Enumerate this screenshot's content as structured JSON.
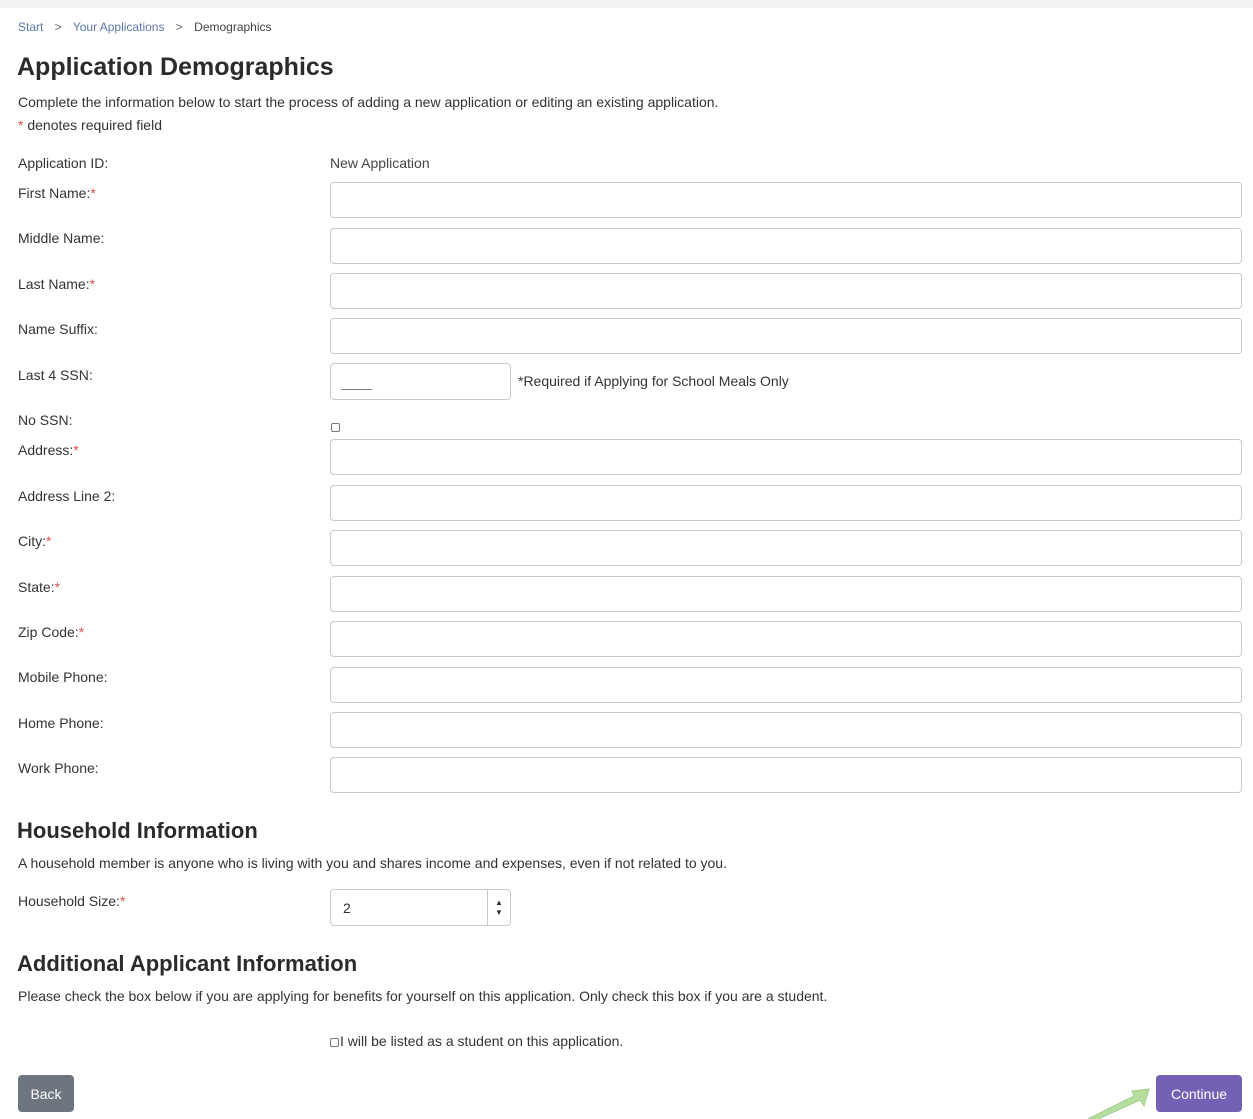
{
  "breadcrumb": {
    "items": [
      "Start",
      "Your Applications",
      "Demographics"
    ],
    "separator": ">"
  },
  "title": "Application Demographics",
  "intro": "Complete the information below to start the process of adding a new application or editing an existing application.",
  "required_note": {
    "asterisk": "*",
    "text": " denotes required field"
  },
  "fields": {
    "application_id": {
      "label": "Application ID:",
      "value": "New Application"
    },
    "first_name": {
      "label": "First Name:",
      "required": "*",
      "value": ""
    },
    "middle_name": {
      "label": "Middle Name:",
      "value": ""
    },
    "last_name": {
      "label": "Last Name:",
      "required": "*",
      "value": ""
    },
    "name_suffix": {
      "label": "Name Suffix:",
      "value": ""
    },
    "last4_ssn": {
      "label": "Last 4 SSN:",
      "placeholder": "____",
      "note": "*Required if Applying for School Meals Only"
    },
    "no_ssn": {
      "label": "No SSN:",
      "checked": false
    },
    "address": {
      "label": "Address:",
      "required": "*",
      "value": ""
    },
    "address2": {
      "label": "Address Line 2:",
      "value": ""
    },
    "city": {
      "label": "City:",
      "required": "*",
      "value": ""
    },
    "state": {
      "label": "State:",
      "required": "*",
      "value": ""
    },
    "zip": {
      "label": "Zip Code:",
      "required": "*",
      "value": ""
    },
    "mobile_phone": {
      "label": "Mobile Phone:",
      "value": ""
    },
    "home_phone": {
      "label": "Home Phone:",
      "value": ""
    },
    "work_phone": {
      "label": "Work Phone:",
      "value": ""
    }
  },
  "household": {
    "heading": "Household Information",
    "description": "A household member is anyone who is living with you and shares income and expenses, even if not related to you.",
    "size_label": "Household Size:",
    "size_required": "*",
    "size_value": "2"
  },
  "additional": {
    "heading": "Additional Applicant Information",
    "description": "Please check the box below if you are applying for benefits for yourself on this application. Only check this box if you are a student.",
    "student_label": "I will be listed as a student on this application.",
    "student_checked": false
  },
  "buttons": {
    "back": "Back",
    "continue": "Continue"
  },
  "colors": {
    "link": "#5b77a8",
    "required": "#d9534f",
    "back_button": "#6d767e",
    "continue_button": "#7461b6",
    "pointer_arrow": "#b6df9f"
  },
  "icons": {
    "spinner_up": "▲",
    "spinner_down": "▼",
    "pointer": "green-arrow-icon"
  }
}
